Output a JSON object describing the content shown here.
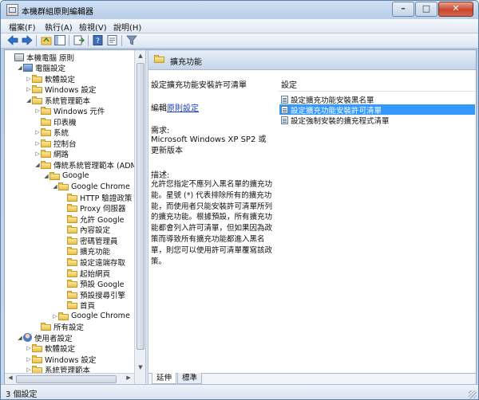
{
  "window": {
    "title": "本機群組原則編輯器",
    "min": "–",
    "max": "□",
    "close": "✕"
  },
  "menu": [
    "檔案(F)",
    "執行(A)",
    "檢視(V)",
    "說明(H)"
  ],
  "tree": [
    {
      "label": "本機電腦 原則",
      "depth": 0,
      "icon": "policy-icon",
      "tw": ""
    },
    {
      "label": "電腦設定",
      "depth": 1,
      "icon": "computer-icon",
      "tw": "◢"
    },
    {
      "label": "軟體設定",
      "depth": 2,
      "icon": "folder",
      "tw": "▷"
    },
    {
      "label": "Windows 設定",
      "depth": 2,
      "icon": "folder",
      "tw": "▷"
    },
    {
      "label": "系統管理範本",
      "depth": 2,
      "icon": "folder",
      "tw": "◢"
    },
    {
      "label": "Windows 元件",
      "depth": 3,
      "icon": "folder",
      "tw": "▷"
    },
    {
      "label": "印表機",
      "depth": 3,
      "icon": "folder",
      "tw": ""
    },
    {
      "label": "系統",
      "depth": 3,
      "icon": "folder",
      "tw": "▷"
    },
    {
      "label": "控制台",
      "depth": 3,
      "icon": "folder",
      "tw": "▷"
    },
    {
      "label": "網路",
      "depth": 3,
      "icon": "folder",
      "tw": "▷"
    },
    {
      "label": "傳統系統管理範本 (ADM)",
      "depth": 3,
      "icon": "folder",
      "tw": "◢"
    },
    {
      "label": "Google",
      "depth": 4,
      "icon": "folder",
      "tw": "◢"
    },
    {
      "label": "Google Chrome",
      "depth": 5,
      "icon": "folder",
      "tw": "◢"
    },
    {
      "label": "HTTP 驗證政策",
      "depth": 6,
      "icon": "folder",
      "tw": ""
    },
    {
      "label": "Proxy 伺服器",
      "depth": 6,
      "icon": "folder",
      "tw": ""
    },
    {
      "label": "允許 Google",
      "depth": 6,
      "icon": "folder",
      "tw": ""
    },
    {
      "label": "內容設定",
      "depth": 6,
      "icon": "folder",
      "tw": ""
    },
    {
      "label": "密碼管理員",
      "depth": 6,
      "icon": "folder",
      "tw": ""
    },
    {
      "label": "擴充功能",
      "depth": 6,
      "icon": "folder",
      "tw": ""
    },
    {
      "label": "設定遠端存取",
      "depth": 6,
      "icon": "folder",
      "tw": ""
    },
    {
      "label": "起始網頁",
      "depth": 6,
      "icon": "folder",
      "tw": ""
    },
    {
      "label": "預設 Google",
      "depth": 6,
      "icon": "folder",
      "tw": ""
    },
    {
      "label": "預設搜尋引擎",
      "depth": 6,
      "icon": "folder",
      "tw": ""
    },
    {
      "label": "首頁",
      "depth": 6,
      "icon": "folder",
      "tw": ""
    },
    {
      "label": "Google Chrome",
      "depth": 5,
      "icon": "folder",
      "tw": "▷"
    },
    {
      "label": "所有設定",
      "depth": 3,
      "icon": "folder",
      "tw": ""
    },
    {
      "label": "使用者設定",
      "depth": 1,
      "icon": "user-icon",
      "tw": "◢"
    },
    {
      "label": "軟體設定",
      "depth": 2,
      "icon": "folder",
      "tw": "▷"
    },
    {
      "label": "Windows 設定",
      "depth": 2,
      "icon": "folder",
      "tw": "▷"
    },
    {
      "label": "系統管理範本",
      "depth": 2,
      "icon": "folder",
      "tw": "▷"
    }
  ],
  "right_header": "擴充功能",
  "description": {
    "title": "設定擴充功能安裝許可清單",
    "edit_label": "編輯",
    "edit_link": "原則設定",
    "requirements_label": "需求:",
    "requirements": "Microsoft Windows XP SP2 或更新版本",
    "desc_label": "描述:",
    "desc": "允許您指定不應列入黑名單的擴充功能。星號 (*) 代表排除所有的擴充功能，而使用者只能安裝許可清單所列的擴充功能。根據預設，所有擴充功能都會列入許可清單，但如果因為政策而導致所有擴充功能都進入黑名單，則您可以使用許可清單覆寫該政策。"
  },
  "list": {
    "column_header": "設定",
    "items": [
      {
        "label": "設定擴充功能安裝黑名單",
        "selected": false
      },
      {
        "label": "設定擴充功能安裝許可清單",
        "selected": true
      },
      {
        "label": "設定強制安裝的擴充程式清單",
        "selected": false
      }
    ]
  },
  "tabs": [
    "延伸",
    "標準"
  ],
  "status": "3 個設定"
}
